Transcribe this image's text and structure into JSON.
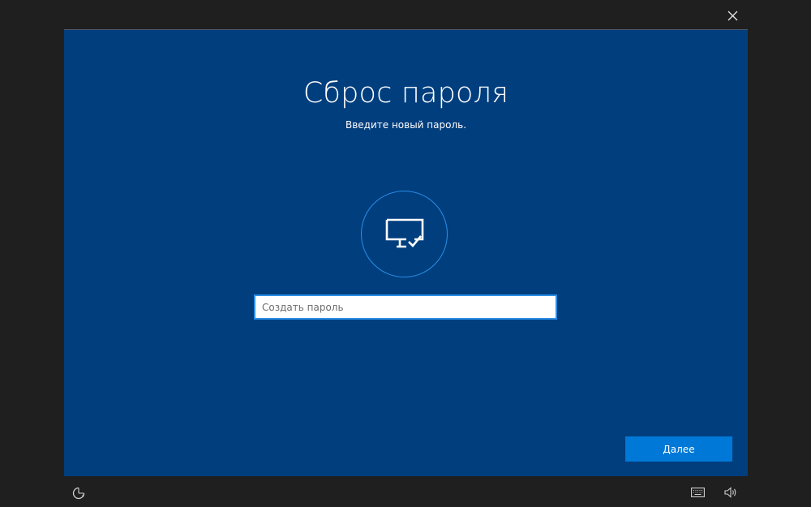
{
  "header": {
    "close_icon": "close-icon"
  },
  "dialog": {
    "title": "Сброс пароля",
    "subtitle": "Введите новый пароль.",
    "avatar_icon": "monitor-check-icon",
    "password_placeholder": "Создать пароль",
    "password_value": "",
    "next_label": "Далее"
  },
  "taskbar": {
    "ease_of_access_icon": "ease-of-access-icon",
    "keyboard_icon": "keyboard-icon",
    "volume_icon": "volume-icon"
  },
  "colors": {
    "background": "#1f1f1f",
    "panel": "#003e7e",
    "accent": "#0078d7",
    "ring": "#2b8fe6"
  }
}
